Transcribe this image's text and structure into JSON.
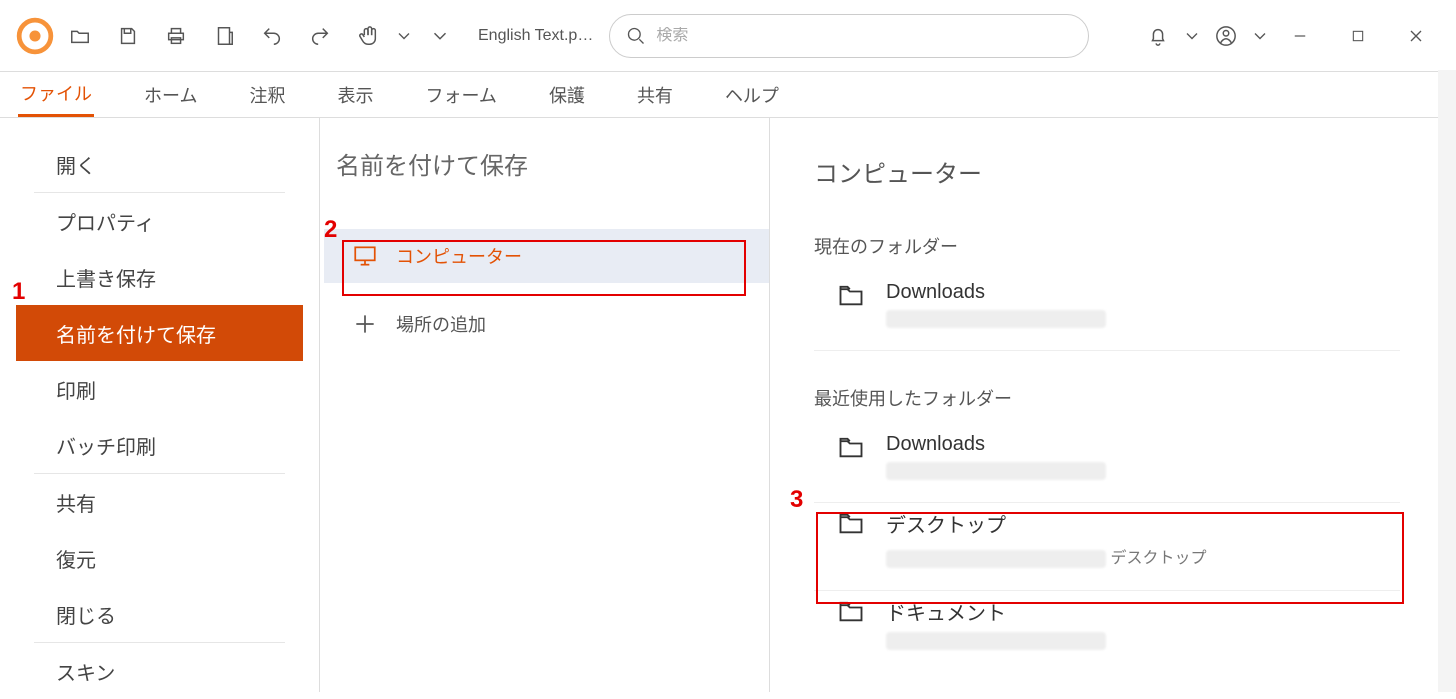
{
  "toolbar": {
    "doc_title": "English Text.p…",
    "search_placeholder": "検索"
  },
  "ribbon": {
    "tabs": [
      "ファイル",
      "ホーム",
      "注釈",
      "表示",
      "フォーム",
      "保護",
      "共有",
      "ヘルプ"
    ],
    "active_index": 0
  },
  "file_menu": {
    "items": [
      {
        "label": "開く"
      },
      {
        "label": "プロパティ"
      },
      {
        "label": "上書き保存"
      },
      {
        "label": "名前を付けて保存",
        "selected": true
      },
      {
        "label": "印刷"
      },
      {
        "label": "バッチ印刷"
      },
      {
        "label": "共有"
      },
      {
        "label": "復元"
      },
      {
        "label": "閉じる"
      },
      {
        "label": "スキン"
      }
    ],
    "dividers_after": [
      0,
      5,
      8
    ]
  },
  "save_as": {
    "title": "名前を付けて保存",
    "locations": [
      {
        "label": "コンピューター",
        "icon": "computer-icon",
        "selected": true
      },
      {
        "label": "場所の追加",
        "icon": "plus-icon"
      }
    ]
  },
  "computer_panel": {
    "title": "コンピューター",
    "current_folder_header": "現在のフォルダー",
    "current_folders": [
      {
        "name": "Downloads",
        "path_suffix": ""
      }
    ],
    "recent_folder_header": "最近使用したフォルダー",
    "recent_folders": [
      {
        "name": "Downloads",
        "path_suffix": ""
      },
      {
        "name": "デスクトップ",
        "path_suffix": "デスクトップ"
      },
      {
        "name": "ドキュメント",
        "path_suffix": ""
      }
    ]
  },
  "annotations": {
    "step1": "1",
    "step2": "2",
    "step3": "3"
  }
}
